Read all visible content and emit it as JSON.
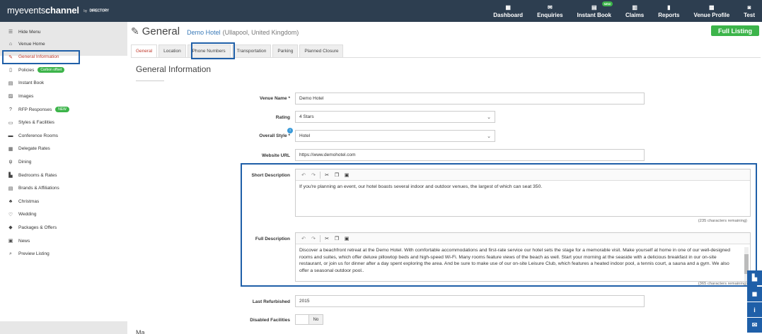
{
  "brand": {
    "name_prefix": "myevents",
    "name_suffix": "channel",
    "by": "by",
    "directory": "DIRECTORY"
  },
  "nav": [
    {
      "label": "Dashboard",
      "icon": "dashboard-icon",
      "glyph": "▦"
    },
    {
      "label": "Enquiries",
      "icon": "envelope-icon",
      "glyph": "✉"
    },
    {
      "label": "Instant Book",
      "icon": "calendar-icon",
      "glyph": "▤",
      "badge": "NEW"
    },
    {
      "label": "Claims",
      "icon": "claims-icon",
      "glyph": "▥"
    },
    {
      "label": "Reports",
      "icon": "bar-chart-icon",
      "glyph": "▮"
    },
    {
      "label": "Venue Profile",
      "icon": "venue-icon",
      "glyph": "▩"
    },
    {
      "label": "Test",
      "icon": "user-icon",
      "glyph": "◙"
    }
  ],
  "sidebar": {
    "hide_menu": "Hide Menu",
    "items": [
      {
        "label": "Venue Home",
        "glyph": "⌂",
        "icon": "home-icon"
      },
      {
        "label": "General Information",
        "glyph": "✎",
        "icon": "edit-icon",
        "active": true
      },
      {
        "label": "Policies",
        "glyph": "▯",
        "icon": "document-icon",
        "pill": "Carbon offset"
      },
      {
        "label": "Instant Book",
        "glyph": "▤",
        "icon": "calendar-icon"
      },
      {
        "label": "Images",
        "glyph": "▨",
        "icon": "image-icon"
      },
      {
        "label": "RFP Responses",
        "glyph": "?",
        "icon": "question-icon",
        "pill": "NEW"
      },
      {
        "label": "Styles & Facilities",
        "glyph": "▭",
        "icon": "monitor-icon"
      },
      {
        "label": "Conference Rooms",
        "glyph": "▬",
        "icon": "briefcase-icon"
      },
      {
        "label": "Delegate Rates",
        "glyph": "▦",
        "icon": "table-icon"
      },
      {
        "label": "Dining",
        "glyph": "ψ",
        "icon": "cutlery-icon"
      },
      {
        "label": "Bedrooms & Rates",
        "glyph": "▙",
        "icon": "bed-icon"
      },
      {
        "label": "Brands & Affiliations",
        "glyph": "▤",
        "icon": "list-icon"
      },
      {
        "label": "Christmas",
        "glyph": "♣",
        "icon": "tree-icon"
      },
      {
        "label": "Wedding",
        "glyph": "♡",
        "icon": "heart-icon"
      },
      {
        "label": "Packages & Offers",
        "glyph": "◆",
        "icon": "tag-icon"
      },
      {
        "label": "News",
        "glyph": "▣",
        "icon": "newspaper-icon"
      },
      {
        "label": "Preview Listing",
        "glyph": "⌕",
        "icon": "search-icon"
      }
    ]
  },
  "header": {
    "title": "General",
    "venue_name": "Demo Hotel",
    "venue_location": "(Ullapool, United Kingdom)",
    "listing_badge": "Full Listing"
  },
  "tabs": [
    "General",
    "Location",
    "Phone Numbers",
    "Transportation",
    "Parking",
    "Planned Closure"
  ],
  "section_title": "General Information",
  "form": {
    "venue_name_label": "Venue Name *",
    "venue_name_value": "Demo Hotel",
    "rating_label": "Rating",
    "rating_value": "4 Stars",
    "style_label": "Overall Style *",
    "style_value": "Hotel",
    "info_badge": "i",
    "website_label": "Website URL",
    "website_value": "https://www.demohotel.com",
    "short_desc_label": "Short Description",
    "short_desc_value": "If you're planning an event, our hotel boasts several indoor and outdoor venues, the largest of which can seat 350.",
    "short_desc_remaining": "(235 characters remaining)",
    "full_desc_label": "Full Description",
    "full_desc_value": "Discover a beachfront retreat at the Demo Hotel. With comfortable accommodations and first-rate service our hotel sets the stage for a memorable visit. Make yourself at home in one of our well-designed rooms and suites, which offer deluxe pillowtop beds and high-speed Wi-Fi. Many rooms feature views of the beach as well. Start your morning at the seaside with a delicious breakfast in our on-site restaurant, or join us for dinner after a day spent exploring the area. And be sure to make use of our on-site Leisure Club, which features a heated indoor pool, a tennis court, a sauna and a gym. We also offer a seasonal outdoor pool..",
    "full_desc_remaining": "(365 characters remaining)",
    "refurbished_label": "Last Refurbished",
    "refurbished_value": "2015",
    "disabled_label": "Disabled Facilities",
    "disabled_value": "No"
  },
  "toolbar": {
    "undo": "↶",
    "redo": "↷",
    "cut": "✂",
    "copy": "❐",
    "paste": "▣"
  },
  "cut_heading": "Ma",
  "float_buttons": [
    {
      "name": "help-book-icon",
      "glyph": "▙"
    },
    {
      "name": "chat-icon",
      "glyph": "◼"
    },
    {
      "name": "info-icon",
      "glyph": "i"
    },
    {
      "name": "mail-icon",
      "glyph": "✉"
    }
  ],
  "colors": {
    "topbar": "#2d3e50",
    "accent": "#1f5fa8",
    "green": "#3cb44a",
    "active": "#c0392b"
  }
}
